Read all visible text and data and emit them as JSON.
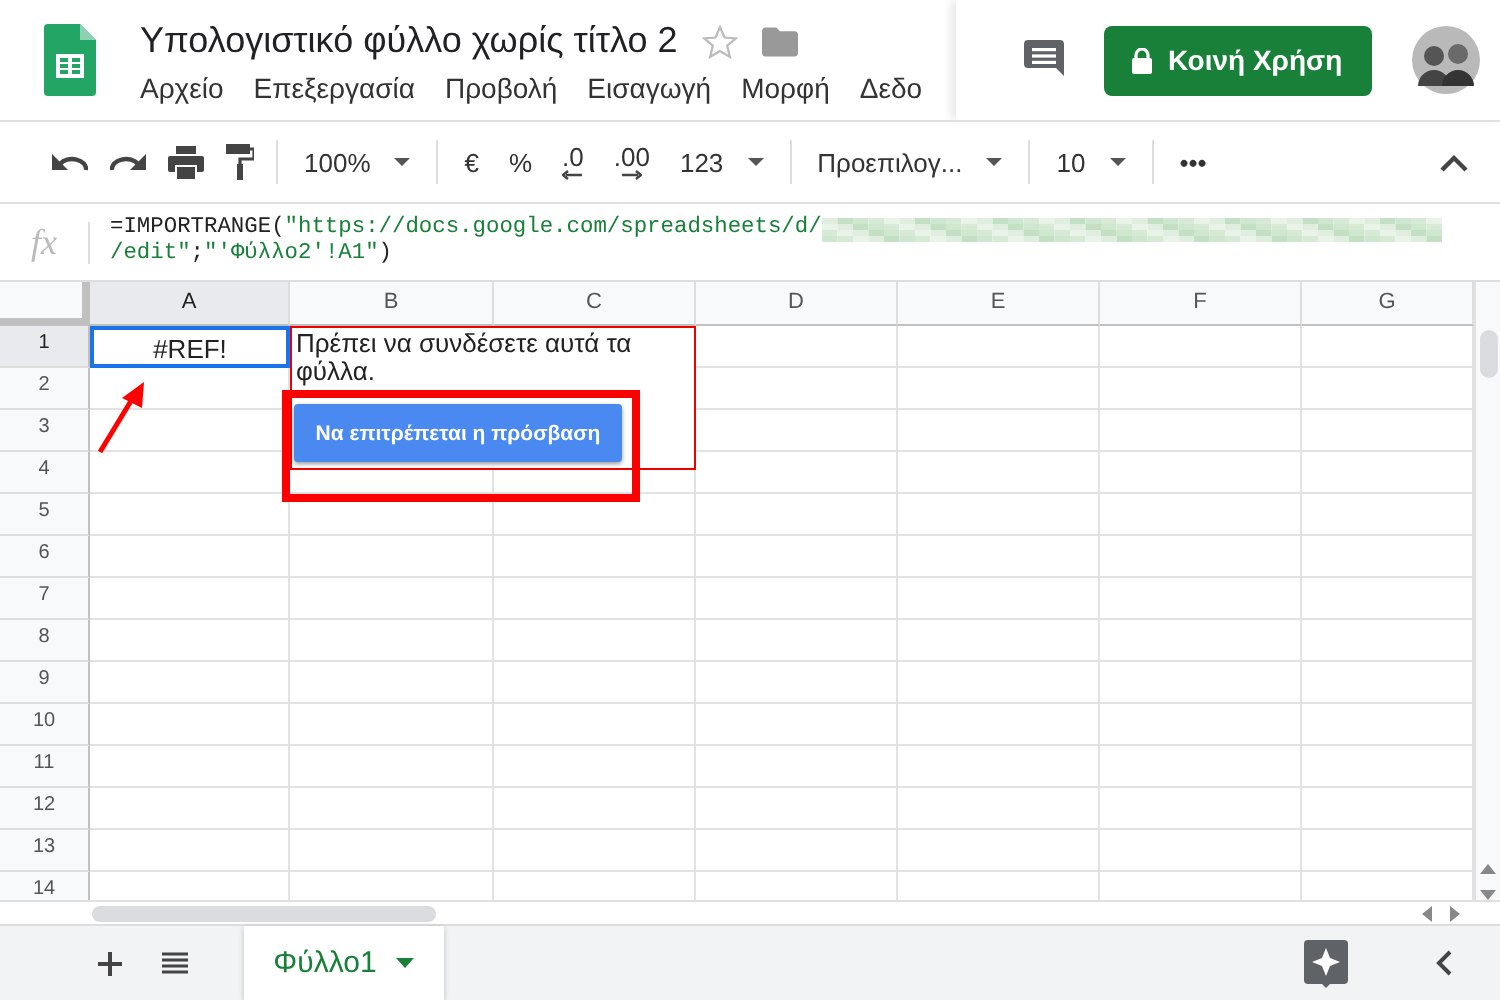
{
  "document": {
    "title": "Υπολογιστικό φύλλο χωρίς τίτλο 2",
    "starred": false
  },
  "menu": [
    "Αρχείο",
    "Επεξεργασία",
    "Προβολή",
    "Εισαγωγή",
    "Μορφή",
    "Δεδο"
  ],
  "share_button": {
    "label": "Κοινή Χρήση"
  },
  "toolbar": [
    {
      "kind": "undo"
    },
    {
      "kind": "redo"
    },
    {
      "kind": "print"
    },
    {
      "kind": "paint"
    },
    {
      "kind": "sep"
    },
    {
      "kind": "dropdown",
      "label": "100%"
    },
    {
      "kind": "sep"
    },
    {
      "kind": "text",
      "label": "€"
    },
    {
      "kind": "text",
      "label": "%"
    },
    {
      "kind": "decimal_less",
      "label": ".0"
    },
    {
      "kind": "decimal_more",
      "label": ".00"
    },
    {
      "kind": "dropdown",
      "label": "123"
    },
    {
      "kind": "sep"
    },
    {
      "kind": "dropdown",
      "label": "Προεπιλογ..."
    },
    {
      "kind": "sep"
    },
    {
      "kind": "dropdown",
      "label": "10"
    },
    {
      "kind": "sep"
    },
    {
      "kind": "text",
      "label": "•••"
    }
  ],
  "formula_bar": {
    "label": "fx",
    "lines": [
      [
        {
          "kind": "plain",
          "text": "=IMPORTRANGE("
        },
        {
          "kind": "string",
          "text": "\"https://docs.google.com/spreadsheets/d/"
        },
        {
          "kind": "redacted"
        }
      ],
      [
        {
          "kind": "string",
          "text": "/edit\""
        },
        {
          "kind": "plain",
          "text": ";"
        },
        {
          "kind": "string",
          "text": "\"'Φύλλο2'!A1\""
        },
        {
          "kind": "plain",
          "text": ")"
        }
      ]
    ]
  },
  "columns": [
    {
      "label": "A",
      "selected": true
    },
    {
      "label": "B",
      "selected": false
    },
    {
      "label": "C",
      "selected": false
    },
    {
      "label": "D",
      "selected": false
    },
    {
      "label": "E",
      "selected": false
    },
    {
      "label": "F",
      "selected": false
    },
    {
      "label": "G",
      "selected": false
    }
  ],
  "rows": [
    {
      "label": "1",
      "selected": true,
      "cells": [
        "#REF!"
      ]
    },
    {
      "label": "2",
      "selected": false
    },
    {
      "label": "3",
      "selected": false
    },
    {
      "label": "4",
      "selected": false
    },
    {
      "label": "5",
      "selected": false
    },
    {
      "label": "6",
      "selected": false
    },
    {
      "label": "7",
      "selected": false
    },
    {
      "label": "8",
      "selected": false
    },
    {
      "label": "9",
      "selected": false
    },
    {
      "label": "10",
      "selected": false
    },
    {
      "label": "11",
      "selected": false
    },
    {
      "label": "12",
      "selected": false
    },
    {
      "label": "13",
      "selected": false
    },
    {
      "label": "14",
      "selected": false
    }
  ],
  "popup": {
    "message": "Πρέπει να συνδέσετε αυτά τα φύλλα.",
    "button": "Να επιτρέπεται η πρόσβαση"
  },
  "sheet_tabs": [
    {
      "label": "Φύλλο1",
      "selected": true
    }
  ]
}
